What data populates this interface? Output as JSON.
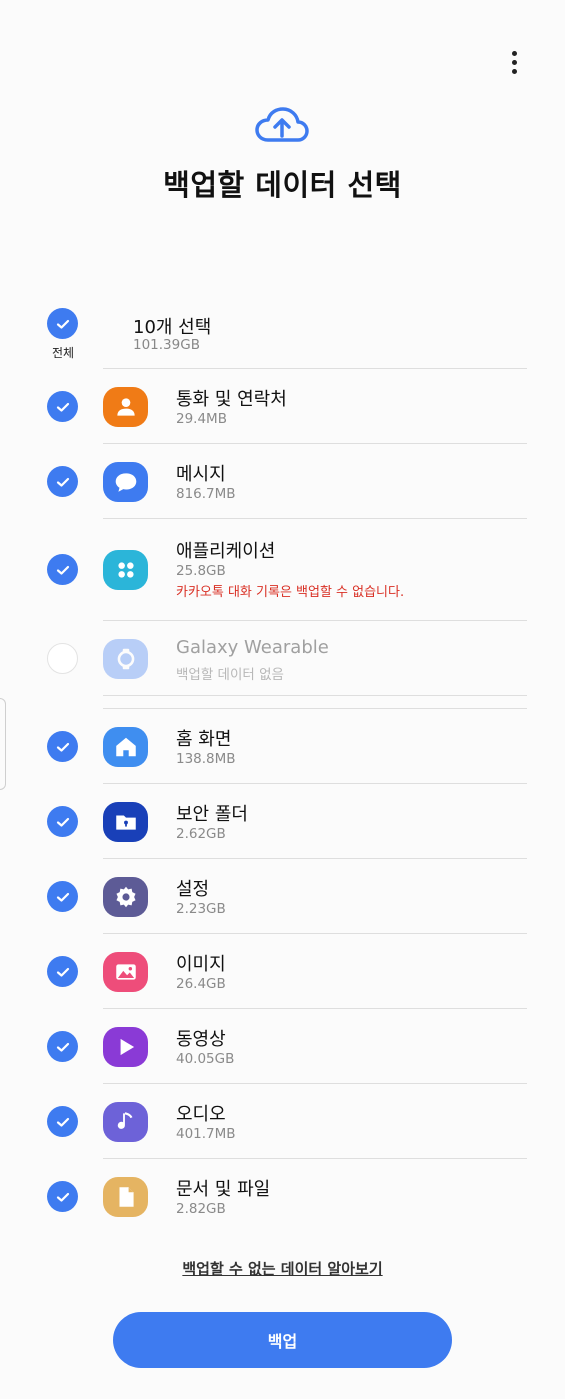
{
  "header": {
    "title": "백업할 데이터 선택",
    "cloud_icon": "cloud-upload-icon",
    "more_icon": "more-vertical-icon"
  },
  "select_all": {
    "caption": "전체",
    "title": "10개 선택",
    "size": "101.39GB",
    "checked": true
  },
  "items": [
    {
      "title": "통화 및 연락처",
      "size": "29.4MB",
      "checked": true,
      "icon": "contact-icon",
      "icon_color": "#f07b16"
    },
    {
      "title": "메시지",
      "size": "816.7MB",
      "checked": true,
      "icon": "message-icon",
      "icon_color": "#3e7bf0"
    },
    {
      "title": "애플리케이션",
      "size": "25.8GB",
      "warning": "카카오톡 대화 기록은 백업할 수 없습니다.",
      "checked": true,
      "icon": "apps-icon",
      "icon_color": "#2bb5d9"
    },
    {
      "title": "Galaxy Wearable",
      "size": "백업할 데이터 없음",
      "checked": false,
      "disabled": true,
      "icon": "watch-icon",
      "icon_color": "#3e7bf0"
    },
    {
      "title": "홈 화면",
      "size": "138.8MB",
      "checked": true,
      "icon": "home-icon",
      "icon_color": "#3f8ef0"
    },
    {
      "title": "보안 폴더",
      "size": "2.62GB",
      "checked": true,
      "icon": "secure-folder-icon",
      "icon_color": "#1940b8"
    },
    {
      "title": "설정",
      "size": "2.23GB",
      "checked": true,
      "icon": "gear-icon",
      "icon_color": "#5d5b96"
    },
    {
      "title": "이미지",
      "size": "26.4GB",
      "checked": true,
      "icon": "image-icon",
      "icon_color": "#ee4d7a"
    },
    {
      "title": "동영상",
      "size": "40.05GB",
      "checked": true,
      "icon": "video-icon",
      "icon_color": "#8a3ad6"
    },
    {
      "title": "오디오",
      "size": "401.7MB",
      "checked": true,
      "icon": "audio-icon",
      "icon_color": "#6d62d8"
    },
    {
      "title": "문서 및 파일",
      "size": "2.82GB",
      "checked": true,
      "icon": "document-icon",
      "icon_color": "#e5b462"
    }
  ],
  "footer": {
    "link": "백업할 수 없는 데이터 알아보기",
    "backup_button": "백업"
  },
  "colors": {
    "accent": "#3e7bf0",
    "warning": "#d93025"
  }
}
